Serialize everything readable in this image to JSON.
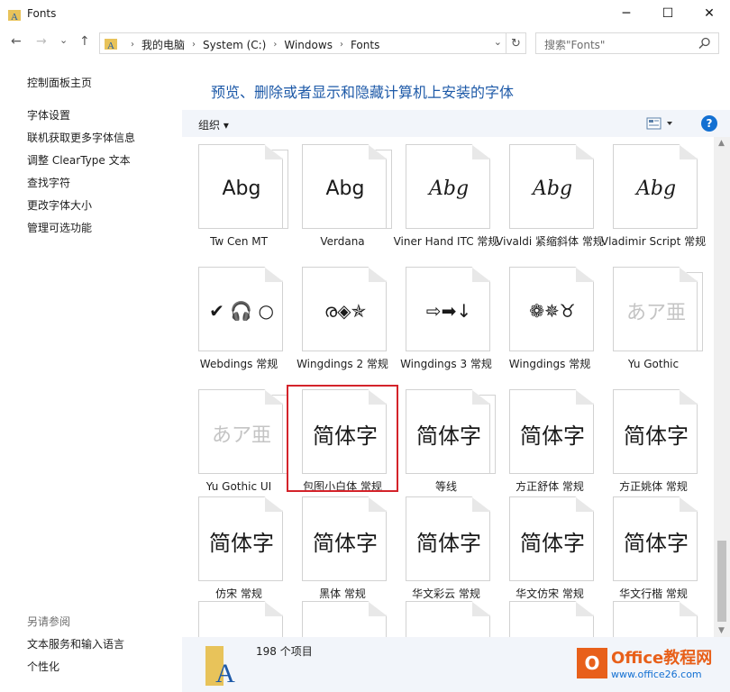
{
  "window": {
    "title": "Fonts",
    "minimize": "─",
    "maximize": "☐",
    "close": "✕"
  },
  "nav": {
    "back": "←",
    "forward": "→",
    "recent": "⌄",
    "up": "↑",
    "breadcrumbs": [
      "我的电脑",
      "System (C:)",
      "Windows",
      "Fonts"
    ],
    "refresh": "↻",
    "search_placeholder": "搜索\"Fonts\""
  },
  "sidebar": {
    "home": "控制面板主页",
    "links": [
      "字体设置",
      "联机获取更多字体信息",
      "调整 ClearType 文本",
      "查找字符",
      "更改字体大小",
      "管理可选功能"
    ],
    "see_also_title": "另请参阅",
    "see_also": [
      "文本服务和输入语言",
      "个性化"
    ]
  },
  "main": {
    "heading": "预览、删除或者显示和隐藏计算机上安装的字体",
    "organize": "组织 ▾",
    "help": "?"
  },
  "fonts": [
    {
      "sample": "Abg",
      "label": "Tw Cen MT",
      "stacked": true,
      "style": "sans"
    },
    {
      "sample": "Abg",
      "label": "Verdana",
      "stacked": true,
      "style": "sans"
    },
    {
      "sample": "Abg",
      "label": "Viner Hand ITC 常规",
      "stacked": false,
      "style": "script"
    },
    {
      "sample": "Abg",
      "label": "Vivaldi 紧缩斜体 常规",
      "stacked": false,
      "style": "script"
    },
    {
      "sample": "Abg",
      "label": "Vladimir Script 常规",
      "stacked": false,
      "style": "script"
    },
    {
      "sample": "✔ 🎧 ○",
      "label": "Webdings 常规",
      "stacked": false,
      "style": "symbol"
    },
    {
      "sample": "ര◈✯",
      "label": "Wingdings 2 常规",
      "stacked": false,
      "style": "symbol"
    },
    {
      "sample": "⇨➡↓",
      "label": "Wingdings 3 常规",
      "stacked": false,
      "style": "symbol"
    },
    {
      "sample": "❁✵♉",
      "label": "Wingdings 常规",
      "stacked": false,
      "style": "symbol"
    },
    {
      "sample": "あア亜",
      "label": "Yu Gothic",
      "stacked": true,
      "style": "faded"
    },
    {
      "sample": "あア亜",
      "label": "Yu Gothic UI",
      "stacked": true,
      "style": "faded"
    },
    {
      "sample": "简体字",
      "label": "包图小白体 常规",
      "stacked": false,
      "style": "cjk"
    },
    {
      "sample": "简体字",
      "label": "等线",
      "stacked": true,
      "style": "cjk"
    },
    {
      "sample": "简体字",
      "label": "方正舒体 常规",
      "stacked": false,
      "style": "cjk"
    },
    {
      "sample": "简体字",
      "label": "方正姚体 常规",
      "stacked": false,
      "style": "cjk"
    },
    {
      "sample": "简体字",
      "label": "仿宋 常规",
      "stacked": false,
      "style": "cjk"
    },
    {
      "sample": "简体字",
      "label": "黑体 常规",
      "stacked": false,
      "style": "cjk"
    },
    {
      "sample": "简体字",
      "label": "华文彩云 常规",
      "stacked": false,
      "style": "cjk"
    },
    {
      "sample": "简体字",
      "label": "华文仿宋 常规",
      "stacked": false,
      "style": "cjk"
    },
    {
      "sample": "简体字",
      "label": "华文行楷 常规",
      "stacked": false,
      "style": "cjk"
    },
    {
      "sample": "",
      "label": "",
      "stacked": false,
      "style": "cjk"
    },
    {
      "sample": "",
      "label": "",
      "stacked": false,
      "style": "cjk"
    },
    {
      "sample": "",
      "label": "",
      "stacked": false,
      "style": "cjk"
    },
    {
      "sample": "",
      "label": "",
      "stacked": false,
      "style": "cjk"
    },
    {
      "sample": "",
      "label": "",
      "stacked": false,
      "style": "cjk"
    }
  ],
  "selected_font": "包图小白体 常规",
  "details": {
    "count": "198 个项目"
  },
  "watermark": {
    "logo": "O",
    "line1": "Office教程网",
    "line2": "www.office26.com"
  },
  "colors": {
    "accent": "#1370d2",
    "heading": "#1e5aa8",
    "selection": "#d4232a",
    "brand": "#e8601a"
  }
}
